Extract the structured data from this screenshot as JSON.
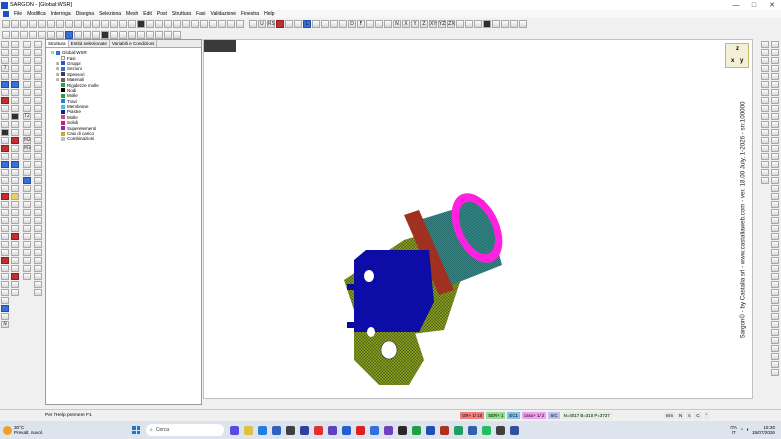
{
  "window": {
    "title": "SARGON - [Global:WSR]",
    "controls": [
      "—",
      "□",
      "✕"
    ]
  },
  "menu": [
    "File",
    "Modifica",
    "Interroga",
    "Disegna",
    "Seleziona",
    "Mesh",
    "Edit",
    "Post",
    "Struttura",
    "Fasi",
    "Validazione",
    "Finestra",
    "Help"
  ],
  "toolbar_row1_letters": [
    "U",
    "RS",
    "L",
    "D",
    "F",
    "N",
    "X",
    "Y",
    "Z",
    "XY",
    "YZ",
    "ZX"
  ],
  "left_vtb_labels": [
    "7",
    "G",
    "S",
    "W",
    "M",
    "T2",
    "M2",
    "M3",
    "N"
  ],
  "panel": {
    "tabs": [
      "Struttura",
      "Entità selezionate",
      "Variabili e Condizioni"
    ],
    "tree": [
      {
        "label": "Global:WSR",
        "icon_color": "#3a6fd8",
        "indent": 0,
        "toggle": "⊟"
      },
      {
        "label": "Fasi",
        "icon_color": "#ffffff",
        "indent": 1,
        "toggle": ""
      },
      {
        "label": "Gruppi",
        "icon_color": "#2060c0",
        "indent": 1,
        "toggle": "⊞"
      },
      {
        "label": "Sezioni",
        "icon_color": "#3070d0",
        "indent": 1,
        "toggle": "⊞"
      },
      {
        "label": "Spessori",
        "icon_color": "#404040",
        "indent": 1,
        "toggle": "⊞"
      },
      {
        "label": "Materiali",
        "icon_color": "#606060",
        "indent": 1,
        "toggle": "⊞"
      },
      {
        "label": "Rigidezze molle",
        "icon_color": "#30a030",
        "indent": 1,
        "toggle": ""
      },
      {
        "label": "Nodi",
        "icon_color": "#000000",
        "indent": 1,
        "toggle": ""
      },
      {
        "label": "Molle",
        "icon_color": "#30a030",
        "indent": 1,
        "toggle": ""
      },
      {
        "label": "Travi",
        "icon_color": "#2080e0",
        "indent": 1,
        "toggle": ""
      },
      {
        "label": "Membrane",
        "icon_color": "#40c0e0",
        "indent": 1,
        "toggle": ""
      },
      {
        "label": "Piastre",
        "icon_color": "#102090",
        "indent": 1,
        "toggle": ""
      },
      {
        "label": "Molle",
        "icon_color": "#d040a0",
        "indent": 1,
        "toggle": ""
      },
      {
        "label": "Solidi",
        "icon_color": "#d02050",
        "indent": 1,
        "toggle": ""
      },
      {
        "label": "Superelementi",
        "icon_color": "#8030c0",
        "indent": 1,
        "toggle": ""
      },
      {
        "label": "Casi di carico",
        "icon_color": "#e0a020",
        "indent": 1,
        "toggle": ""
      },
      {
        "label": "Combinazioni",
        "icon_color": "#c0c0c0",
        "indent": 1,
        "toggle": ""
      }
    ]
  },
  "axis": {
    "z": "z",
    "x": "x",
    "y": "y"
  },
  "watermark": "Sargon© - by Castalia srl - www.castaliaweb.com - ver. 18.00 July, 1-2026 - sn:100000",
  "status": {
    "help": "Per l'Help premere F1",
    "badges": [
      {
        "text": "GR+ 1/ 10",
        "bg": "#f08080"
      },
      {
        "text": "SER+ 1",
        "bg": "#90e090"
      },
      {
        "text": "EC1",
        "bg": "#80c0f0"
      },
      {
        "text": "caso+ 1/ 2",
        "bg": "#f0a0f0"
      },
      {
        "text": "SIC",
        "bg": "#c0c0f0"
      },
      {
        "text": "N=4017 B=310 P=3737",
        "bg": "#e0f0e0"
      }
    ],
    "right_badges": [
      "mm",
      "N",
      "s",
      "C",
      "°"
    ]
  },
  "taskbar": {
    "weather_temp": "30°C",
    "weather_desc": "Prevalt. nuvol.",
    "search_placeholder": "Cerca",
    "lang": "ITA",
    "region": "IT",
    "time": "15:30",
    "date": "15/07/2026"
  }
}
